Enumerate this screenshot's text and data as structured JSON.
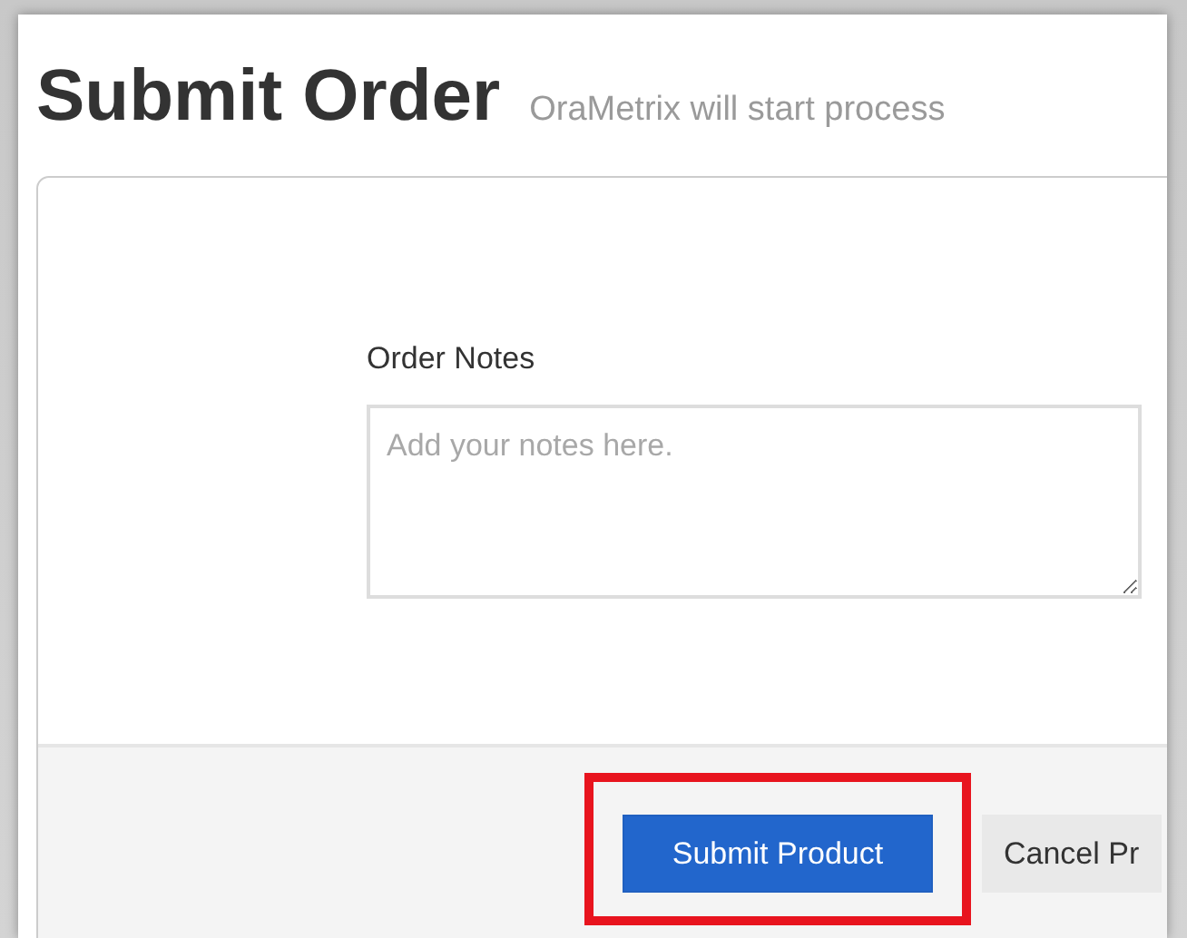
{
  "page": {
    "title": "Submit Order",
    "subtitle": "OraMetrix will start process"
  },
  "form": {
    "label": "Order Notes",
    "placeholder": "Add your notes here."
  },
  "buttons": [
    {
      "label": "Submit Product",
      "kind": "primary",
      "highlighted": true
    },
    {
      "label": "Cancel Pr",
      "kind": "secondary",
      "highlighted": false
    }
  ]
}
